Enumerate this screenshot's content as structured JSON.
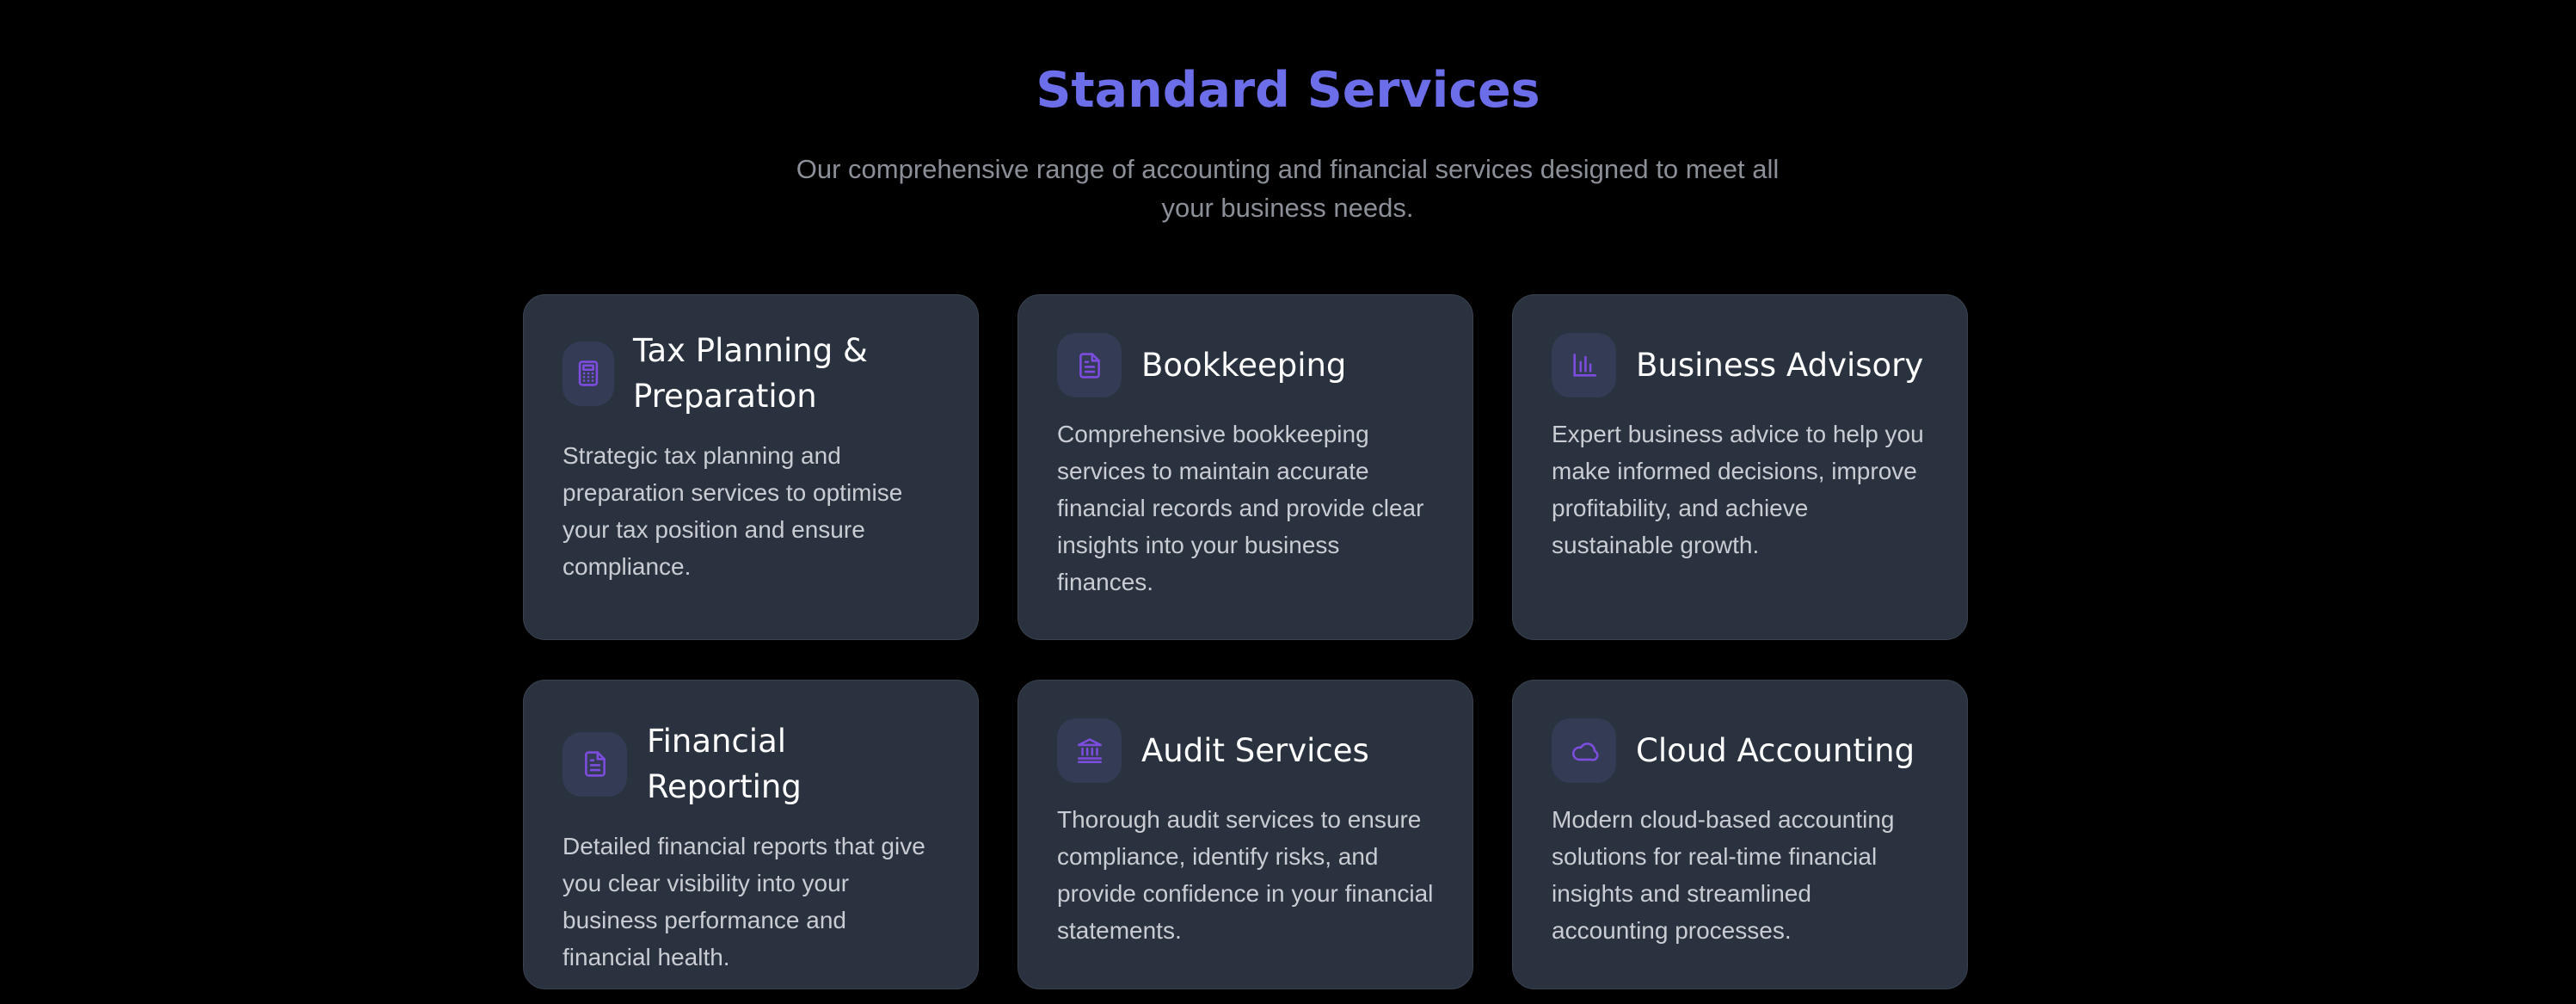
{
  "section": {
    "title": "Standard Services",
    "subtitle": "Our comprehensive range of accounting and financial services designed to meet all your business needs."
  },
  "colors": {
    "background": "#000000",
    "title": "#6b6ee8",
    "card_bg": "#2a323f",
    "icon_bg": "#343c55",
    "icon_stroke": "#7c4dde"
  },
  "services": [
    {
      "icon": "calculator-icon",
      "title": "Tax Planning & Preparation",
      "description": "Strategic tax planning and preparation services to optimise your tax position and ensure compliance."
    },
    {
      "icon": "document-icon",
      "title": "Bookkeeping",
      "description": "Comprehensive bookkeeping services to maintain accurate financial records and provide clear insights into your business finances."
    },
    {
      "icon": "bar-chart-icon",
      "title": "Business Advisory",
      "description": "Expert business advice to help you make informed decisions, improve profitability, and achieve sustainable growth."
    },
    {
      "icon": "report-icon",
      "title": "Financial Reporting",
      "description": "Detailed financial reports that give you clear visibility into your business performance and financial health."
    },
    {
      "icon": "bank-icon",
      "title": "Audit Services",
      "description": "Thorough audit services to ensure compliance, identify risks, and provide confidence in your financial statements."
    },
    {
      "icon": "cloud-icon",
      "title": "Cloud Accounting",
      "description": "Modern cloud-based accounting solutions for real-time financial insights and streamlined accounting processes."
    }
  ]
}
